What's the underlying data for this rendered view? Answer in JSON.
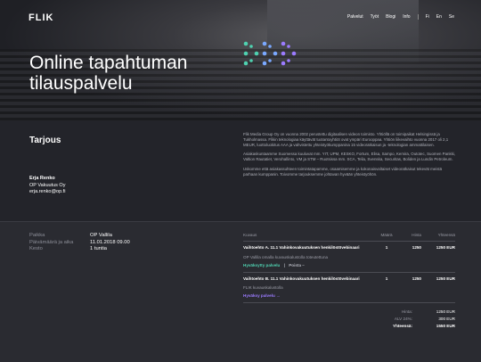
{
  "header": {
    "logo": "FLIK",
    "nav": [
      "Palvelut",
      "Työt",
      "Blogi",
      "Info"
    ],
    "languages": [
      "Fi",
      "En",
      "Se"
    ],
    "title": "Online tapahtuman tilauspalvelu"
  },
  "offer": {
    "title": "Tarjous",
    "contact": {
      "name": "Erja Renko",
      "company": "OP Vakuutus Oy",
      "email": "erja.renko@op.fi"
    },
    "description": [
      "Flik Media Group Oy on vuonna 2002 perustettu digitaalisen videon toimisto. Yhtiöllä on toimipaikat Helsingissä ja Tukholmassa. Flikin teknologiaa käyttävät tuotantoyhtiöt ovat ympäri Eurooppaa. Yhtiön liikevaihto vuonna 2017 oli 2,1 MEUR, luottoluokitus AAA ja vahvistettu yhteistyökumppanina 15 videoratkaisun ja -teknologian ammattilaisen.",
      "Asiakaskuntaamme Suomessa kuuluvat mm. YIT, UPM, KESKO, Fortum, Elisa, Sampo, Kemira, Outotec, Suomen Pankki, Valtion Rautatiet, Verohallinto, VM ja STM – Ruotsissa mm. SCA, Telia, Svenska, Securitas, Boliden ja Lundin Petroleum.",
      "Uskomme että asiakassuhteen toimintatapamme, osaamisemme ja kokonaisvaltaiset videoratkaisut tekevät meistä parhaan kumppanin. Toivomme tarjouksemme johtavan hyvään yhteistyöhön."
    ]
  },
  "meta": [
    {
      "label": "Paikka",
      "value": "OP Vallila"
    },
    {
      "label": "Päivämäärä ja aika",
      "value": "11.01.2018 09.00"
    },
    {
      "label": "Kesto",
      "value": "1 tuntia"
    }
  ],
  "table": {
    "headers": {
      "product": "Kuvaus",
      "qty": "Määrä",
      "price": "Hinta",
      "total": "Yhteensä"
    },
    "items": [
      {
        "name": "Vaihtoehto A. 11.1 Vahinkovakuutuksen henkilöstövebinaari",
        "qty": "1",
        "price": "1250",
        "total": "1250 EUR",
        "note": "OP Vallila omalla kuvauskalustolla toteutettuna",
        "accept": "Hyväksytty palvelu",
        "reject": "Poista –"
      },
      {
        "name": "Vaihtoehto B. 11.1 Vahinkovakuutuksen henkilöstövebinaari",
        "qty": "1",
        "price": "1250",
        "total": "1250 EUR",
        "note": "FLIK kuvauskalustolla",
        "accept": "Hyväksy palvelu →"
      }
    ],
    "totals": [
      {
        "label": "Hinta:",
        "value": "1250 EUR"
      },
      {
        "label": "ALV 24%:",
        "value": "300 EUR"
      },
      {
        "label": "Yhteensä:",
        "value": "1550 EUR"
      }
    ]
  },
  "colors": {
    "accent_teal": "#4fd1b0",
    "accent_purple": "#9b7bff"
  }
}
